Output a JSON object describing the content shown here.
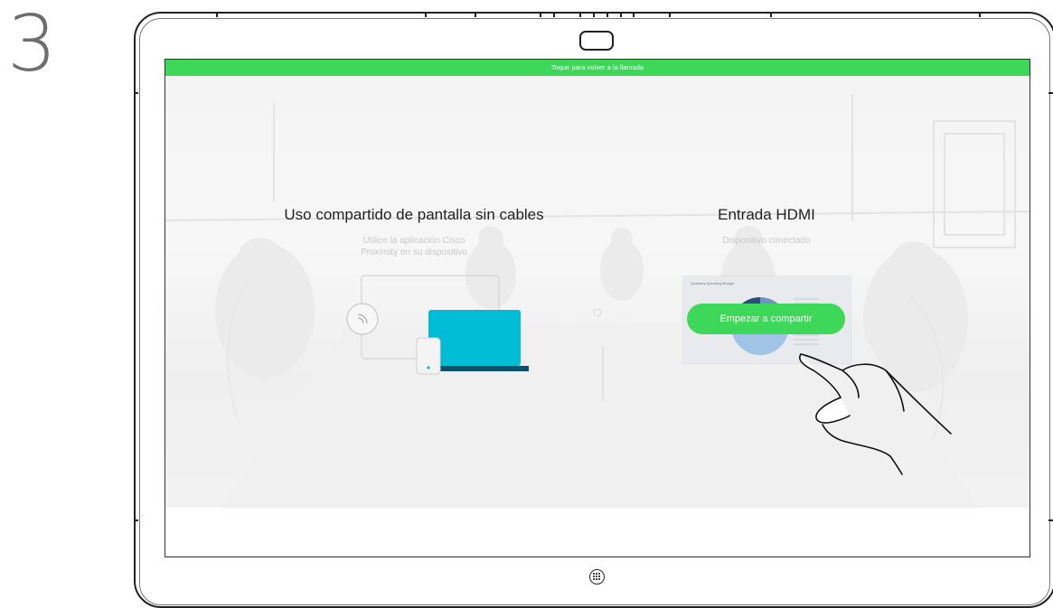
{
  "step": {
    "number": "3"
  },
  "banner": {
    "text": "Toque para volver a la llamada"
  },
  "wireless_share": {
    "title": "Uso compartido de pantalla sin cables",
    "subtitle_line1": "Utilice la aplicación Cisco",
    "subtitle_line2": "Proximity en su dispositivo"
  },
  "hdmi": {
    "title": "Entrada HDMI",
    "subtitle": "Dispositivo conectado",
    "thumbnail_caption": "Quarterly Spending Budget",
    "button_label": "Empezar a compartir"
  },
  "colors": {
    "accent": "#3dd75a",
    "device": "#00bcd4"
  },
  "icons": {
    "camera": "camera-icon",
    "home": "home-keypad-icon",
    "proximity": "proximity-signal-icon",
    "hand": "tapping-hand-icon"
  }
}
